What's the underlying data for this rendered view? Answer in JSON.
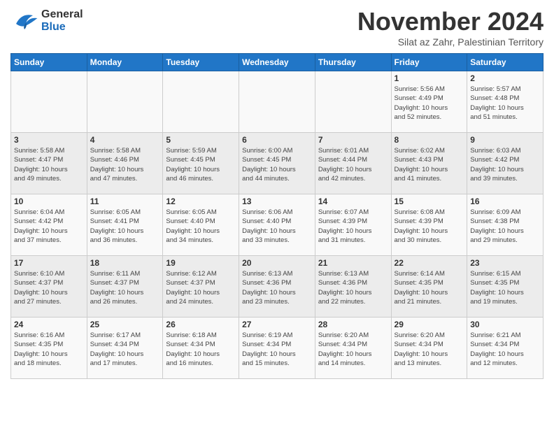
{
  "header": {
    "logo_general": "General",
    "logo_blue": "Blue",
    "month_title": "November 2024",
    "subtitle": "Silat az Zahr, Palestinian Territory"
  },
  "days_of_week": [
    "Sunday",
    "Monday",
    "Tuesday",
    "Wednesday",
    "Thursday",
    "Friday",
    "Saturday"
  ],
  "weeks": [
    [
      {
        "day": "",
        "info": ""
      },
      {
        "day": "",
        "info": ""
      },
      {
        "day": "",
        "info": ""
      },
      {
        "day": "",
        "info": ""
      },
      {
        "day": "",
        "info": ""
      },
      {
        "day": "1",
        "info": "Sunrise: 5:56 AM\nSunset: 4:49 PM\nDaylight: 10 hours\nand 52 minutes."
      },
      {
        "day": "2",
        "info": "Sunrise: 5:57 AM\nSunset: 4:48 PM\nDaylight: 10 hours\nand 51 minutes."
      }
    ],
    [
      {
        "day": "3",
        "info": "Sunrise: 5:58 AM\nSunset: 4:47 PM\nDaylight: 10 hours\nand 49 minutes."
      },
      {
        "day": "4",
        "info": "Sunrise: 5:58 AM\nSunset: 4:46 PM\nDaylight: 10 hours\nand 47 minutes."
      },
      {
        "day": "5",
        "info": "Sunrise: 5:59 AM\nSunset: 4:45 PM\nDaylight: 10 hours\nand 46 minutes."
      },
      {
        "day": "6",
        "info": "Sunrise: 6:00 AM\nSunset: 4:45 PM\nDaylight: 10 hours\nand 44 minutes."
      },
      {
        "day": "7",
        "info": "Sunrise: 6:01 AM\nSunset: 4:44 PM\nDaylight: 10 hours\nand 42 minutes."
      },
      {
        "day": "8",
        "info": "Sunrise: 6:02 AM\nSunset: 4:43 PM\nDaylight: 10 hours\nand 41 minutes."
      },
      {
        "day": "9",
        "info": "Sunrise: 6:03 AM\nSunset: 4:42 PM\nDaylight: 10 hours\nand 39 minutes."
      }
    ],
    [
      {
        "day": "10",
        "info": "Sunrise: 6:04 AM\nSunset: 4:42 PM\nDaylight: 10 hours\nand 37 minutes."
      },
      {
        "day": "11",
        "info": "Sunrise: 6:05 AM\nSunset: 4:41 PM\nDaylight: 10 hours\nand 36 minutes."
      },
      {
        "day": "12",
        "info": "Sunrise: 6:05 AM\nSunset: 4:40 PM\nDaylight: 10 hours\nand 34 minutes."
      },
      {
        "day": "13",
        "info": "Sunrise: 6:06 AM\nSunset: 4:40 PM\nDaylight: 10 hours\nand 33 minutes."
      },
      {
        "day": "14",
        "info": "Sunrise: 6:07 AM\nSunset: 4:39 PM\nDaylight: 10 hours\nand 31 minutes."
      },
      {
        "day": "15",
        "info": "Sunrise: 6:08 AM\nSunset: 4:39 PM\nDaylight: 10 hours\nand 30 minutes."
      },
      {
        "day": "16",
        "info": "Sunrise: 6:09 AM\nSunset: 4:38 PM\nDaylight: 10 hours\nand 29 minutes."
      }
    ],
    [
      {
        "day": "17",
        "info": "Sunrise: 6:10 AM\nSunset: 4:37 PM\nDaylight: 10 hours\nand 27 minutes."
      },
      {
        "day": "18",
        "info": "Sunrise: 6:11 AM\nSunset: 4:37 PM\nDaylight: 10 hours\nand 26 minutes."
      },
      {
        "day": "19",
        "info": "Sunrise: 6:12 AM\nSunset: 4:37 PM\nDaylight: 10 hours\nand 24 minutes."
      },
      {
        "day": "20",
        "info": "Sunrise: 6:13 AM\nSunset: 4:36 PM\nDaylight: 10 hours\nand 23 minutes."
      },
      {
        "day": "21",
        "info": "Sunrise: 6:13 AM\nSunset: 4:36 PM\nDaylight: 10 hours\nand 22 minutes."
      },
      {
        "day": "22",
        "info": "Sunrise: 6:14 AM\nSunset: 4:35 PM\nDaylight: 10 hours\nand 21 minutes."
      },
      {
        "day": "23",
        "info": "Sunrise: 6:15 AM\nSunset: 4:35 PM\nDaylight: 10 hours\nand 19 minutes."
      }
    ],
    [
      {
        "day": "24",
        "info": "Sunrise: 6:16 AM\nSunset: 4:35 PM\nDaylight: 10 hours\nand 18 minutes."
      },
      {
        "day": "25",
        "info": "Sunrise: 6:17 AM\nSunset: 4:34 PM\nDaylight: 10 hours\nand 17 minutes."
      },
      {
        "day": "26",
        "info": "Sunrise: 6:18 AM\nSunset: 4:34 PM\nDaylight: 10 hours\nand 16 minutes."
      },
      {
        "day": "27",
        "info": "Sunrise: 6:19 AM\nSunset: 4:34 PM\nDaylight: 10 hours\nand 15 minutes."
      },
      {
        "day": "28",
        "info": "Sunrise: 6:20 AM\nSunset: 4:34 PM\nDaylight: 10 hours\nand 14 minutes."
      },
      {
        "day": "29",
        "info": "Sunrise: 6:20 AM\nSunset: 4:34 PM\nDaylight: 10 hours\nand 13 minutes."
      },
      {
        "day": "30",
        "info": "Sunrise: 6:21 AM\nSunset: 4:34 PM\nDaylight: 10 hours\nand 12 minutes."
      }
    ]
  ]
}
